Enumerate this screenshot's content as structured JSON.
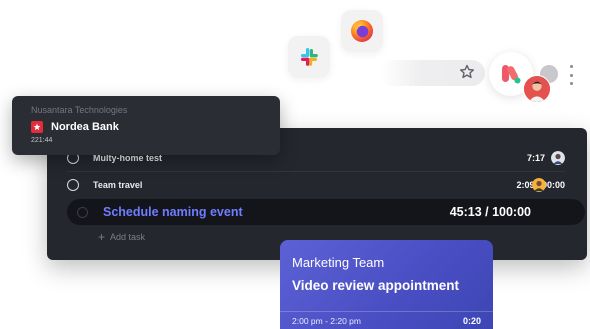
{
  "notification": {
    "company": "Nusantara Technologies",
    "bank": "Nordea Bank",
    "time": "221:44"
  },
  "tasks": [
    {
      "label": "Multy-home test",
      "time": "7:17"
    },
    {
      "label": "Team travel",
      "time": "2:09 / 90:00"
    }
  ],
  "active_task": {
    "label": "Schedule naming event",
    "time": "45:13 / 100:00"
  },
  "add_task_label": "Add task",
  "event": {
    "team": "Marketing Team",
    "title": "Video review appointment",
    "range": "2:00 pm - 2:20 pm",
    "duration": "0:20"
  },
  "colors": {
    "panel": "#25272e",
    "active_label": "#6f7dff",
    "event_card": "#4a4fc4",
    "bank_brand": "#e32b3a",
    "extension_brand": "#f0586a"
  },
  "icons": [
    "slack-icon",
    "firefox-icon",
    "star-icon",
    "extension-logo-icon",
    "kebab-menu-icon"
  ]
}
